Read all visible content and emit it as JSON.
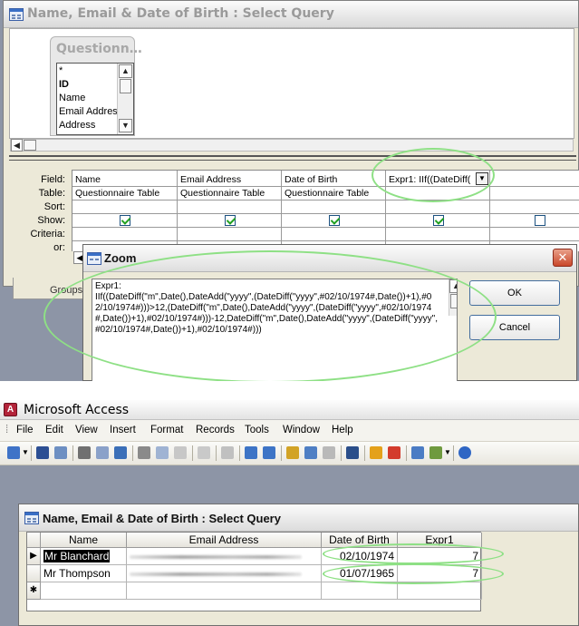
{
  "query_design": {
    "title": "Name, Email & Date of Birth : Select Query",
    "field_list": {
      "title": "Questionn…",
      "items": [
        "*",
        "ID",
        "Name",
        "Email Address",
        "Address"
      ]
    },
    "row_labels": [
      "Field:",
      "Table:",
      "Sort:",
      "Show:",
      "Criteria:",
      "or:"
    ],
    "columns": [
      {
        "field": "Name",
        "table": "Questionnaire Table",
        "show": true
      },
      {
        "field": "Email Address",
        "table": "Questionnaire Table",
        "show": true
      },
      {
        "field": "Date of Birth",
        "table": "Questionnaire Table",
        "show": true
      },
      {
        "field": "Expr1: IIf((DateDiff(",
        "table": "",
        "show": true
      },
      {
        "field": "",
        "table": "",
        "show": false
      }
    ],
    "groups_label": "Groups"
  },
  "zoom_dialog": {
    "title": "Zoom",
    "expression": "Expr1:\nIIf((DateDiff(\"m\",Date(),DateAdd(\"yyyy\",(DateDiff(\"yyyy\",#02/10/1974#,Date())+1),#02/10/1974#)))>12,(DateDiff(\"m\",Date(),DateAdd(\"yyyy\",(DateDiff(\"yyyy\",#02/10/1974#,Date())+1),#02/10/1974#)))-12,DateDiff(\"m\",Date(),DateAdd(\"yyyy\",(DateDiff(\"yyyy\",#02/10/1974#,Date())+1),#02/10/1974#)))",
    "ok_label": "OK",
    "cancel_label": "Cancel",
    "close_glyph": "✕"
  },
  "access": {
    "app_title": "Microsoft Access",
    "logo_letter": "A",
    "menu": [
      "File",
      "Edit",
      "View",
      "Insert",
      "Format",
      "Records",
      "Tools",
      "Window",
      "Help"
    ],
    "toolbar_icons": [
      "view-icon",
      "save-icon",
      "search-icon",
      "print-icon",
      "print-preview-icon",
      "spelling-icon",
      "cut-icon",
      "copy-icon",
      "paste-icon",
      "undo-icon",
      "hyperlink-icon",
      "sort-ascending-icon",
      "sort-descending-icon",
      "filter-by-selection-icon",
      "filter-by-form-icon",
      "apply-filter-icon",
      "find-icon",
      "new-record-icon",
      "delete-record-icon",
      "database-window-icon",
      "new-object-icon",
      "help-icon"
    ]
  },
  "datasheet": {
    "title": "Name, Email & Date of Birth : Select Query",
    "headers": [
      "Name",
      "Email Address",
      "Date of Birth",
      "Expr1"
    ],
    "rows": [
      {
        "name": "Mr Blanchard",
        "dob": "02/10/1974",
        "expr1": "7"
      },
      {
        "name": "Mr Thompson",
        "dob": "01/07/1965",
        "expr1": "7"
      }
    ],
    "row_markers": [
      "▶",
      "",
      "✱"
    ]
  },
  "colors": {
    "annotation": "#8ee085",
    "workspace": "#8d95a6",
    "dialog": "#ece9d8"
  }
}
